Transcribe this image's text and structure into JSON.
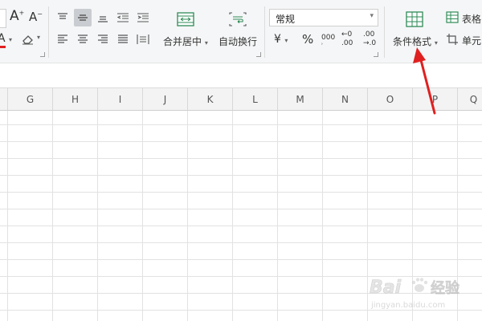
{
  "font_group": {
    "grow_font_label": "A",
    "shrink_font_label": "A",
    "font_color_label": "A",
    "font_color_accent": "#e02020"
  },
  "alignment": {
    "merge_center_label": "合并居中",
    "wrap_text_label": "自动换行"
  },
  "number_format": {
    "selected_format": "常规",
    "currency_symbol": "¥",
    "percent_symbol": "%",
    "thousands_label": "000",
    "increase_decimal_top": "←0",
    "increase_decimal_bottom": ".00",
    "decrease_decimal_top": ".00",
    "decrease_decimal_bottom": "→.0"
  },
  "styles": {
    "conditional_format_label": "条件格式",
    "table_style_label": "表格",
    "cell_style_label": "单元"
  },
  "columns": [
    "G",
    "H",
    "I",
    "J",
    "K",
    "L",
    "M",
    "N",
    "O",
    "P",
    "Q"
  ],
  "watermark": {
    "brand": "Bai",
    "brand_suffix": "经验",
    "url": "jingyan.baidu.com"
  },
  "colors": {
    "toolbar_bg": "#f5f6f7",
    "active_button_bg": "#c9ccd0",
    "arrow_annotation": "#e02020",
    "icon_green": "#2e8b57"
  }
}
